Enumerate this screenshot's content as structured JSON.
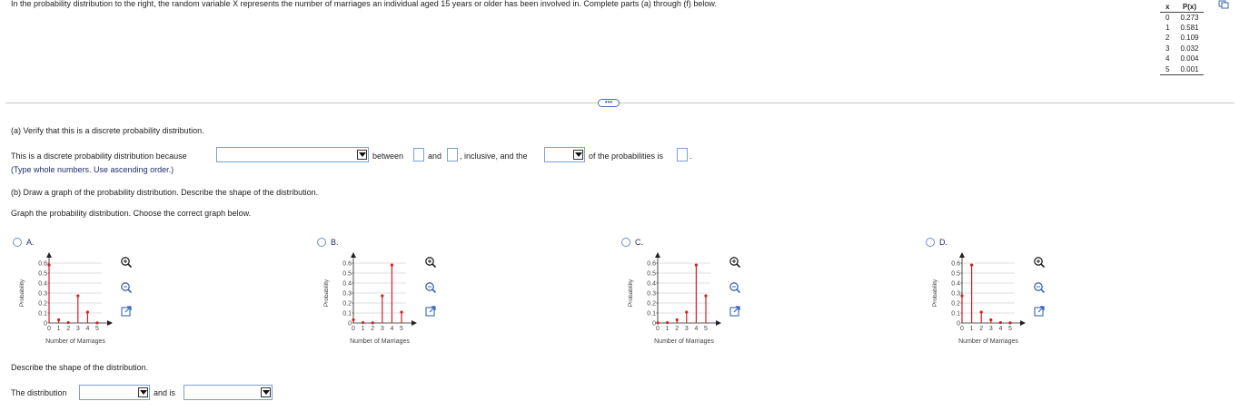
{
  "intro": "In the probability distribution to the right, the random variable X represents the number of marriages an individual aged 15 years or older has been involved in. Complete parts (a) through (f) below.",
  "table": {
    "headers": [
      "x",
      "P(x)"
    ],
    "rows": [
      [
        "0",
        "0.273"
      ],
      [
        "1",
        "0.581"
      ],
      [
        "2",
        "0.109"
      ],
      [
        "3",
        "0.032"
      ],
      [
        "4",
        "0.004"
      ],
      [
        "5",
        "0.001"
      ]
    ]
  },
  "more_button": "•••",
  "part_a": {
    "heading": "(a) Verify that this is a discrete probability distribution.",
    "sentence_start": "This is a discrete probability distribution because",
    "between": "between",
    "and": "and",
    "inclusive": ", inclusive, and the",
    "of_probabilities": "of the probabilities is",
    "period": ".",
    "hint": "(Type whole numbers. Use ascending order.)"
  },
  "part_b": {
    "heading": "(b) Draw a graph of the probability distribution. Describe the shape of the distribution.",
    "instruction": "Graph the probability distribution. Choose the correct graph below.",
    "describe": "Describe the shape of the distribution.",
    "distribution_label": "The distribution",
    "and_is": "and is"
  },
  "colors": {
    "accent": "#1f2d6e",
    "stem": "#d42020",
    "field_border": "#7aa0d6"
  },
  "icons": [
    "copy-icon",
    "zoom-in-icon",
    "zoom-out-icon",
    "expand-icon",
    "dropdown-arrow-icon"
  ],
  "options": [
    {
      "letter": "A.",
      "ylabel": "Probability",
      "xlabel": "Number of Marriages",
      "yticks": [
        "0.6",
        "0.5",
        "0.4",
        "0.3",
        "0.2",
        "0.1",
        "0"
      ],
      "xticks": [
        "0",
        "1",
        "2",
        "3",
        "4",
        "5"
      ],
      "chart_data": {
        "type": "bar",
        "categories": [
          "0",
          "1",
          "2",
          "3",
          "4",
          "5"
        ],
        "values": [
          0.581,
          0.032,
          0.004,
          0.273,
          0.109,
          0.001
        ],
        "ylim": [
          0,
          0.6
        ],
        "xlabel": "Number of Marriages",
        "ylabel": "Probability"
      }
    },
    {
      "letter": "B.",
      "ylabel": "Probability",
      "xlabel": "Number of Marriages",
      "yticks": [
        "0.6",
        "0.5",
        "0.4",
        "0.3",
        "0.2",
        "0.1",
        "0"
      ],
      "xticks": [
        "0",
        "1",
        "2",
        "3",
        "4",
        "5"
      ],
      "chart_data": {
        "type": "bar",
        "categories": [
          "0",
          "1",
          "2",
          "3",
          "4",
          "5"
        ],
        "values": [
          0.032,
          0.004,
          0.001,
          0.273,
          0.581,
          0.109
        ],
        "ylim": [
          0,
          0.6
        ],
        "xlabel": "Number of Marriages",
        "ylabel": "Probability"
      }
    },
    {
      "letter": "C.",
      "ylabel": "Probability",
      "xlabel": "Number of Marriages",
      "yticks": [
        "0.6",
        "0.5",
        "0.4",
        "0.3",
        "0.2",
        "0.1",
        "0"
      ],
      "xticks": [
        "0",
        "1",
        "2",
        "3",
        "4",
        "5"
      ],
      "chart_data": {
        "type": "bar",
        "categories": [
          "0",
          "1",
          "2",
          "3",
          "4",
          "5"
        ],
        "values": [
          0.001,
          0.004,
          0.032,
          0.109,
          0.581,
          0.273
        ],
        "ylim": [
          0,
          0.6
        ],
        "xlabel": "Number of Marriages",
        "ylabel": "Probability"
      }
    },
    {
      "letter": "D.",
      "ylabel": "Probability",
      "xlabel": "Number of Marriages",
      "yticks": [
        "0.6",
        "0.5",
        "0.4",
        "0.3",
        "0.2",
        "0.1",
        "0"
      ],
      "xticks": [
        "0",
        "1",
        "2",
        "3",
        "4",
        "5"
      ],
      "chart_data": {
        "type": "bar",
        "categories": [
          "0",
          "1",
          "2",
          "3",
          "4",
          "5"
        ],
        "values": [
          0.273,
          0.581,
          0.109,
          0.032,
          0.004,
          0.001
        ],
        "ylim": [
          0,
          0.6
        ],
        "xlabel": "Number of Marriages",
        "ylabel": "Probability"
      }
    }
  ]
}
